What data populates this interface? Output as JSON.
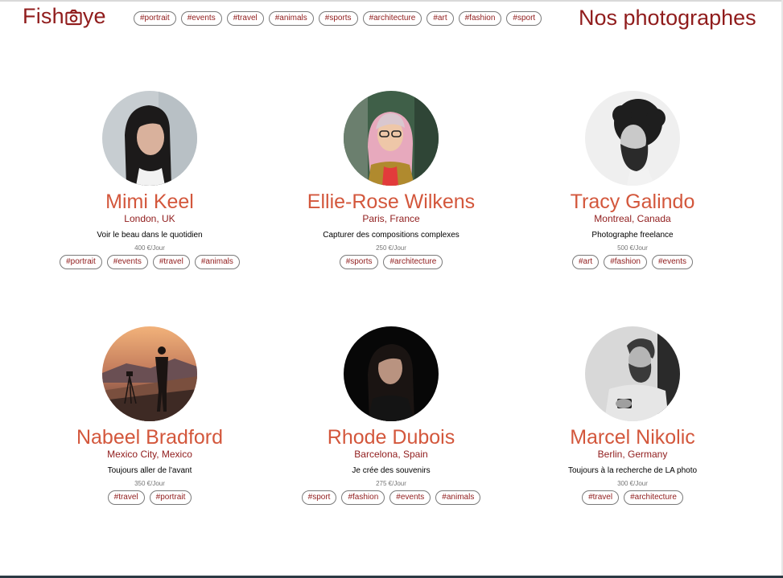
{
  "header": {
    "logo": {
      "before": "Fish",
      "after": "ye"
    },
    "title": "Nos photographes",
    "tags": [
      "#portrait",
      "#events",
      "#travel",
      "#animals",
      "#sports",
      "#architecture",
      "#art",
      "#fashion",
      "#sport"
    ]
  },
  "photographers": [
    {
      "name": "Mimi Keel",
      "location": "London, UK",
      "tagline": "Voir le beau dans le quotidien",
      "price": "400 €/Jour",
      "tags": [
        "#portrait",
        "#events",
        "#travel",
        "#animals"
      ]
    },
    {
      "name": "Ellie-Rose Wilkens",
      "location": "Paris, France",
      "tagline": "Capturer des compositions complexes",
      "price": "250 €/Jour",
      "tags": [
        "#sports",
        "#architecture"
      ]
    },
    {
      "name": "Tracy Galindo",
      "location": "Montreal, Canada",
      "tagline": "Photographe freelance",
      "price": "500 €/Jour",
      "tags": [
        "#art",
        "#fashion",
        "#events"
      ]
    },
    {
      "name": "Nabeel Bradford",
      "location": "Mexico City, Mexico",
      "tagline": "Toujours aller de l'avant",
      "price": "350 €/Jour",
      "tags": [
        "#travel",
        "#portrait"
      ]
    },
    {
      "name": "Rhode Dubois",
      "location": "Barcelona, Spain",
      "tagline": "Je crée des souvenirs",
      "price": "275 €/Jour",
      "tags": [
        "#sport",
        "#fashion",
        "#events",
        "#animals"
      ]
    },
    {
      "name": "Marcel Nikolic",
      "location": "Berlin, Germany",
      "tagline": "Toujours à la recherche de LA photo",
      "price": "300 €/Jour",
      "tags": [
        "#travel",
        "#architecture"
      ]
    }
  ],
  "colors": {
    "brand": "#901c1c",
    "name": "#d3573c",
    "tag_border": "#7a7a7a"
  }
}
